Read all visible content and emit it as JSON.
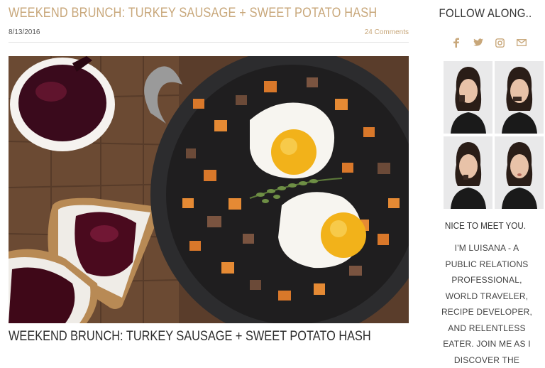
{
  "post": {
    "title": "WEEKEND BRUNCH: TURKEY SAUSAGE + SWEET POTATO HASH",
    "date": "8/13/2016",
    "comments": "24 Comments",
    "bottom_title": "WEEKEND BRUNCH: TURKEY SAUSAGE + SWEET POTATO HASH"
  },
  "sidebar": {
    "follow_heading": "FOLLOW ALONG..",
    "social": [
      "facebook-icon",
      "twitter-icon",
      "instagram-icon",
      "mail-icon"
    ],
    "nice_heading": "NICE TO MEET YOU.",
    "bio": "I'M LUISANA - A PUBLIC RELATIONS PROFESSIONAL, WORLD TRAVELER, RECIPE DEVELOPER, AND RELENTLESS EATER. JOIN ME AS I DISCOVER THE"
  },
  "colors": {
    "accent": "#c8a77a",
    "text": "#333333"
  }
}
